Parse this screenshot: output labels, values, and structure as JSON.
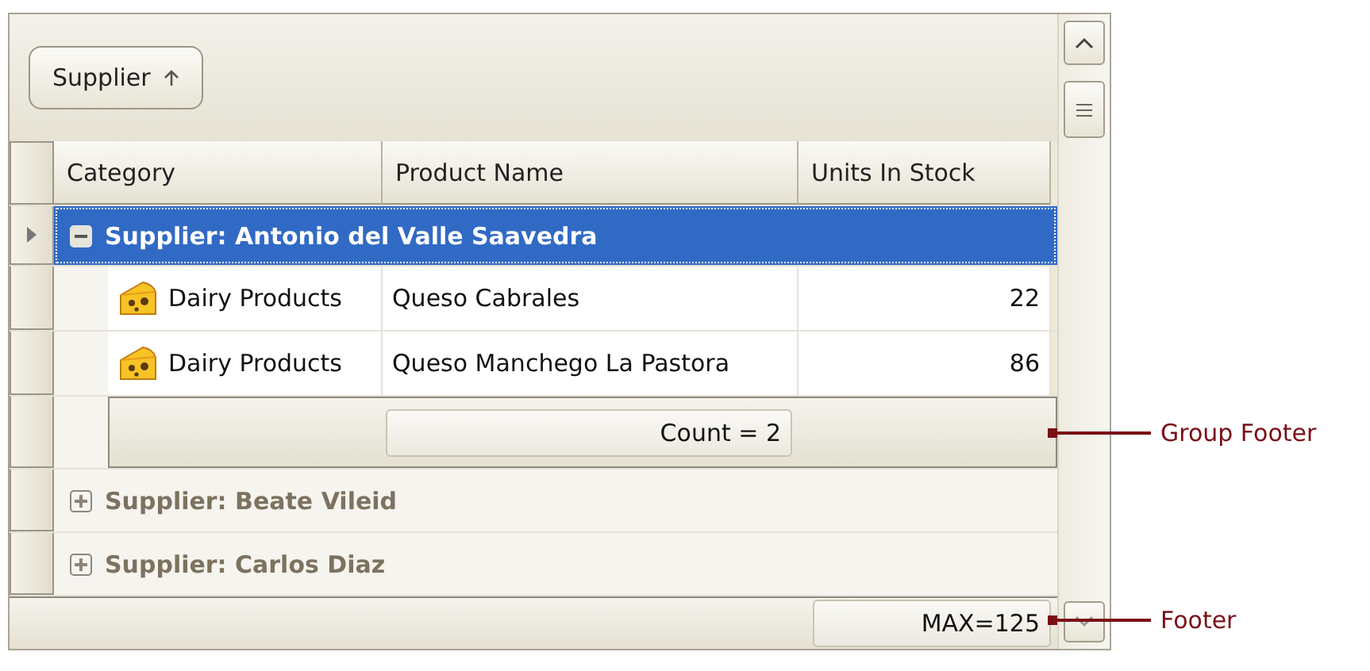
{
  "group_panel": {
    "chips": [
      {
        "label": "Supplier",
        "sort_ascending": true
      }
    ]
  },
  "columns": [
    "Category",
    "Product Name",
    "Units In Stock"
  ],
  "groups": [
    {
      "label": "Supplier: Antonio del Valle Saavedra",
      "expanded": true,
      "selected": true,
      "rows": [
        {
          "category": "Dairy Products",
          "product": "Queso Cabrales",
          "units": "22"
        },
        {
          "category": "Dairy Products",
          "product": "Queso Manchego La Pastora",
          "units": "86"
        }
      ],
      "group_footer": "Count = 2"
    },
    {
      "label": "Supplier: Beate Vileid",
      "expanded": false,
      "selected": false
    },
    {
      "label": "Supplier: Carlos Diaz",
      "expanded": false,
      "selected": false
    }
  ],
  "footer": "MAX=125",
  "group_footer_callout": "Group Footer",
  "footer_callout": "Footer"
}
